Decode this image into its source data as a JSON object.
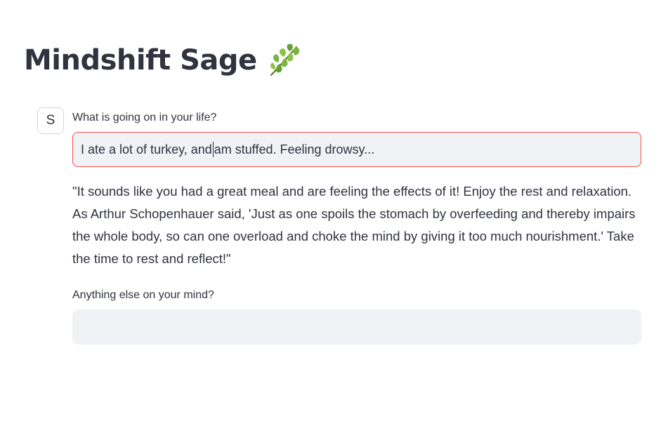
{
  "app": {
    "title": "Mindshift Sage",
    "title_icon": "herb-leaf-icon"
  },
  "chat": {
    "avatar_letter": "S",
    "first_prompt": {
      "label": "What is going on in your life?",
      "value_before_caret": "I ate a lot of turkey, and",
      "value_after_caret": "am stuffed. Feeling drowsy...",
      "state": "focused"
    },
    "response": "\"It sounds like you had a great meal and are feeling the effects of it! Enjoy the rest and relaxation. As Arthur Schopenhauer said, 'Just as one spoils the stomach by overfeeding and thereby impairs the whole body, so can one overload and choke the mind by giving it too much nourishment.' Take the time to rest and reflect!\"",
    "second_prompt": {
      "label": "Anything else on your mind?",
      "value": ""
    }
  },
  "colors": {
    "text": "#31333f",
    "input_bg": "#f0f2f6",
    "focus_border": "#ff4b4b",
    "leaf_green": "#4caf50"
  }
}
